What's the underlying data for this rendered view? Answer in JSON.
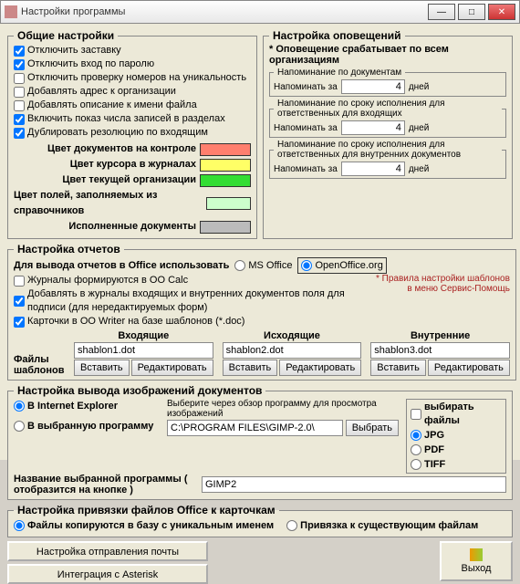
{
  "window": {
    "title": "Настройки программы"
  },
  "general": {
    "legend": "Общие настройки",
    "options": [
      {
        "label": "Отключить заставку",
        "checked": true
      },
      {
        "label": "Отключить вход по паролю",
        "checked": true
      },
      {
        "label": "Отключить проверку номеров на уникальность",
        "checked": false
      },
      {
        "label": "Добавлять адрес к организации",
        "checked": false
      },
      {
        "label": "Добавлять описание к имени файла",
        "checked": false
      },
      {
        "label": "Включить показ числа записей в разделах",
        "checked": true
      },
      {
        "label": "Дублировать резолюцию по входящим",
        "checked": true
      }
    ],
    "colors": [
      {
        "label": "Цвет документов на контроле",
        "value": "#ff7f6e"
      },
      {
        "label": "Цвет курсора в журналах",
        "value": "#ffff66"
      },
      {
        "label": "Цвет текущей организации",
        "value": "#33dd33"
      },
      {
        "label": "Цвет полей, заполняемых из справочников",
        "value": "#ccffcc"
      },
      {
        "label": "Исполненные документы",
        "value": "#bbbbbb"
      }
    ]
  },
  "notify": {
    "legend": "Настройка оповещений",
    "all_orgs": "* Оповещение срабатывает по всем организациям",
    "remind_label": "Напоминать за",
    "days": "дней",
    "groups": [
      {
        "legend": "Напоминание по документам",
        "value": "4"
      },
      {
        "legend": "Напоминание по сроку исполнения для ответственных для входящих",
        "value": "4"
      },
      {
        "legend": "Напоминание по сроку исполнения для ответственных для внутренних документов",
        "value": "4"
      }
    ]
  },
  "reports": {
    "legend": "Настройка отчетов",
    "office_label": "Для вывода отчетов в Office использовать",
    "office_ms": "MS Office",
    "office_oo": "OpenOffice.org",
    "opts": [
      {
        "label": "Журналы формируются в OO Calc",
        "checked": false
      },
      {
        "label": "Добавлять в журналы входящих и внутренних документов поля для подписи (для нередактируемых форм)",
        "checked": true
      },
      {
        "label": "Карточки в OO Writer на базе шаблонов (*.doc)",
        "checked": true
      }
    ],
    "note": "* Правила настройки шаблонов в меню Сервис-Помощь",
    "files_label": "Файлы шаблонов",
    "cols": [
      "Входящие",
      "Исходящие",
      "Внутренние"
    ],
    "files": [
      "shablon1.dot",
      "shablon2.dot",
      "shablon3.dot"
    ],
    "insert": "Вставить",
    "edit": "Редактировать"
  },
  "images": {
    "legend": "Настройка вывода изображений документов",
    "ie": "В Internet Explorer",
    "chosen": "В выбранную программу",
    "hint": "Выберите через обзор программу для просмотра изображений",
    "path": "C:\\PROGRAM FILES\\GIMP-2.0\\",
    "browse": "Выбрать",
    "name_label": "Название выбранной программы ( отобразится на кнопке )",
    "name": "GIMP2",
    "choose_files": "выбирать файлы",
    "fmt_jpg": "JPG",
    "fmt_pdf": "PDF",
    "fmt_tiff": "TIFF"
  },
  "bind": {
    "legend": "Настройка привязки файлов Office к карточкам",
    "copy": "Файлы копируются в базу с уникальным именем",
    "link": "Привязка к существующим файлам"
  },
  "footer": {
    "mail": "Настройка отправления почты",
    "asterisk": "Интеграция с Asterisk",
    "exit": "Выход"
  }
}
